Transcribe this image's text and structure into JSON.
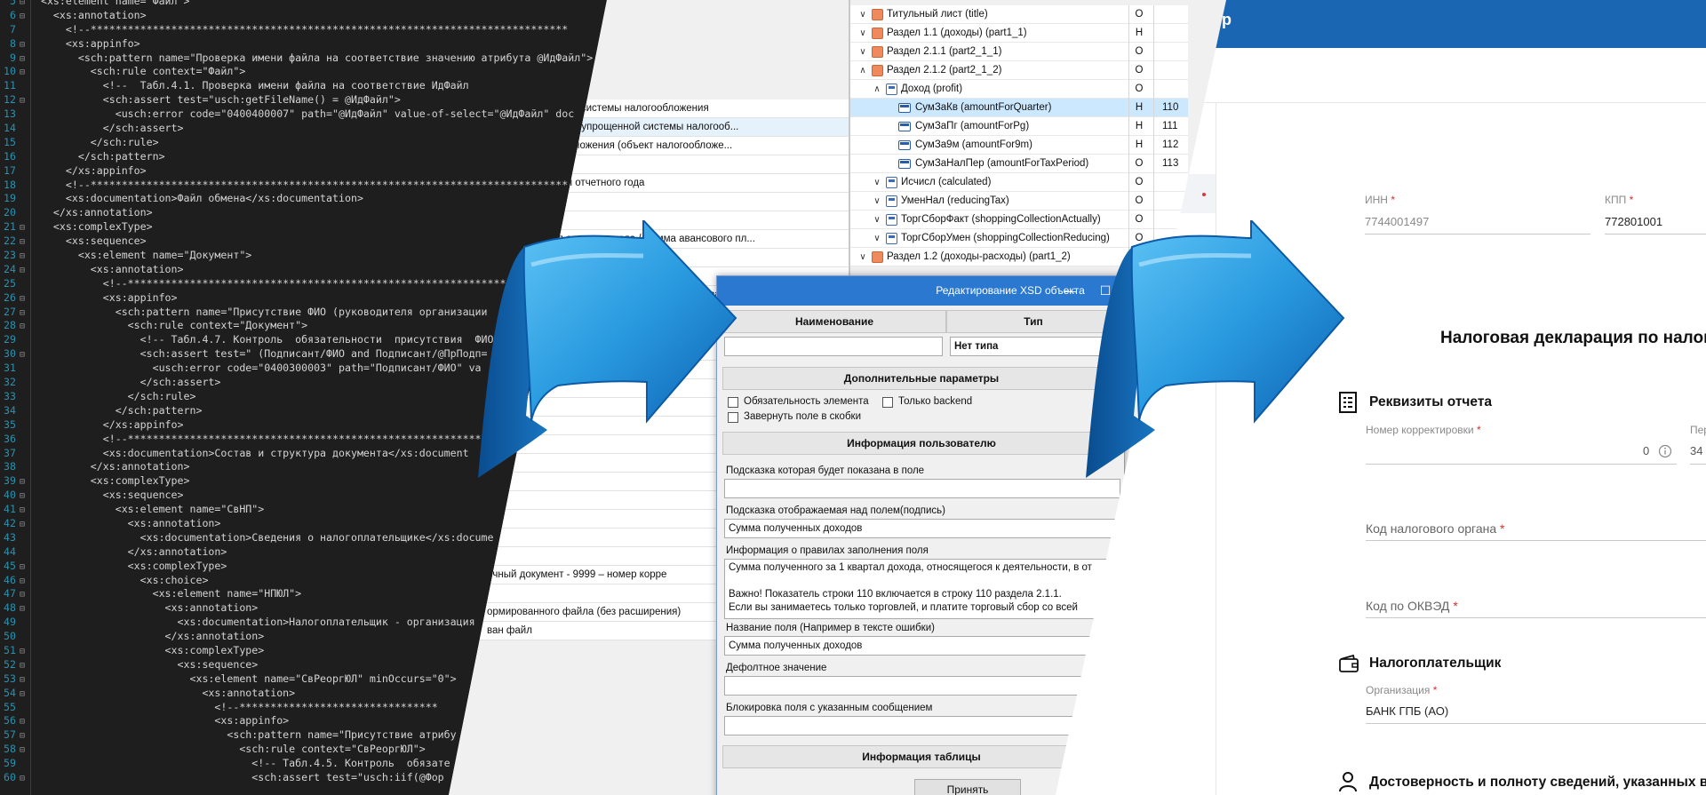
{
  "editor": {
    "lines": [
      {
        "n": "5",
        "fold": "⊟",
        "text": "  <xs:element name=\"Файл\">"
      },
      {
        "n": "6",
        "fold": "⊟",
        "text": "    <xs:annotation>"
      },
      {
        "n": "7",
        "fold": "",
        "text": "      <!--*****************************************************************************"
      },
      {
        "n": "8",
        "fold": "⊟",
        "text": "      <xs:appinfo>"
      },
      {
        "n": "9",
        "fold": "⊟",
        "text": "        <sch:pattern name=\"Проверка имени файла на соответствие значению атрибута @ИдФайл\">"
      },
      {
        "n": "10",
        "fold": "⊟",
        "text": "          <sch:rule context=\"Файл\">"
      },
      {
        "n": "11",
        "fold": "",
        "text": "            <!--  Табл.4.1. Проверка имени файла на соответствие ИдФайл"
      },
      {
        "n": "12",
        "fold": "⊟",
        "text": "            <sch:assert test=\"usch:getFileName() = @ИдФайл\">"
      },
      {
        "n": "13",
        "fold": "",
        "text": "              <usch:error code=\"0400400007\" path=\"@ИдФайл\" value-of-select=\"@ИдФайл\" doc"
      },
      {
        "n": "14",
        "fold": "",
        "text": "            </sch:assert>"
      },
      {
        "n": "15",
        "fold": "",
        "text": "          </sch:rule>"
      },
      {
        "n": "16",
        "fold": "",
        "text": "        </sch:pattern>"
      },
      {
        "n": "17",
        "fold": "",
        "text": "      </xs:appinfo>"
      },
      {
        "n": "18",
        "fold": "",
        "text": "      <!--*****************************************************************************"
      },
      {
        "n": "19",
        "fold": "",
        "text": "      <xs:documentation>Файл обмена</xs:documentation>"
      },
      {
        "n": "20",
        "fold": "",
        "text": "    </xs:annotation>"
      },
      {
        "n": "21",
        "fold": "⊟",
        "text": "    <xs:complexType>"
      },
      {
        "n": "22",
        "fold": "⊟",
        "text": "      <xs:sequence>"
      },
      {
        "n": "23",
        "fold": "⊟",
        "text": "        <xs:element name=\"Документ\">"
      },
      {
        "n": "24",
        "fold": "⊟",
        "text": "          <xs:annotation>"
      },
      {
        "n": "25",
        "fold": "",
        "text": "            <!--*************************************************************************"
      },
      {
        "n": "26",
        "fold": "⊟",
        "text": "            <xs:appinfo>"
      },
      {
        "n": "27",
        "fold": "⊟",
        "text": "              <sch:pattern name=\"Присутствие ФИО (руководителя организации"
      },
      {
        "n": "28",
        "fold": "⊟",
        "text": "                <sch:rule context=\"Документ\">"
      },
      {
        "n": "29",
        "fold": "",
        "text": "                  <!-- Табл.4.7. Контроль  обязательности  присутствия  ФИО"
      },
      {
        "n": "30",
        "fold": "⊟",
        "text": "                  <sch:assert test=\" (Подписант/ФИО and Подписант/@ПрПодп="
      },
      {
        "n": "31",
        "fold": "",
        "text": "                    <usch:error code=\"0400300003\" path=\"Подписант/ФИО\" va"
      },
      {
        "n": "32",
        "fold": "",
        "text": "                  </sch:assert>"
      },
      {
        "n": "33",
        "fold": "",
        "text": "                </sch:rule>"
      },
      {
        "n": "34",
        "fold": "",
        "text": "              </sch:pattern>"
      },
      {
        "n": "35",
        "fold": "",
        "text": "            </xs:appinfo>"
      },
      {
        "n": "36",
        "fold": "",
        "text": "            <!--*************************************************************************"
      },
      {
        "n": "37",
        "fold": "",
        "text": "            <xs:documentation>Состав и структура документа</xs:document"
      },
      {
        "n": "38",
        "fold": "",
        "text": "          </xs:annotation>"
      },
      {
        "n": "39",
        "fold": "⊟",
        "text": "          <xs:complexType>"
      },
      {
        "n": "40",
        "fold": "⊟",
        "text": "            <xs:sequence>"
      },
      {
        "n": "41",
        "fold": "⊟",
        "text": "              <xs:element name=\"СвНП\">"
      },
      {
        "n": "42",
        "fold": "⊟",
        "text": "                <xs:annotation>"
      },
      {
        "n": "43",
        "fold": "",
        "text": "                  <xs:documentation>Сведения о налогоплательщике</xs:docume"
      },
      {
        "n": "44",
        "fold": "",
        "text": "                </xs:annotation>"
      },
      {
        "n": "45",
        "fold": "⊟",
        "text": "                <xs:complexType>"
      },
      {
        "n": "46",
        "fold": "⊟",
        "text": "                  <xs:choice>"
      },
      {
        "n": "47",
        "fold": "⊟",
        "text": "                    <xs:element name=\"НПЮЛ\">"
      },
      {
        "n": "48",
        "fold": "⊟",
        "text": "                      <xs:annotation>"
      },
      {
        "n": "49",
        "fold": "",
        "text": "                        <xs:documentation>Налогоплательщик - организация"
      },
      {
        "n": "50",
        "fold": "",
        "text": "                      </xs:annotation>"
      },
      {
        "n": "51",
        "fold": "⊟",
        "text": "                      <xs:complexType>"
      },
      {
        "n": "52",
        "fold": "⊟",
        "text": "                        <xs:sequence>"
      },
      {
        "n": "53",
        "fold": "⊟",
        "text": "                          <xs:element name=\"СвРеоргЮЛ\" minOccurs=\"0\">"
      },
      {
        "n": "54",
        "fold": "⊟",
        "text": "                            <xs:annotation>"
      },
      {
        "n": "55",
        "fold": "",
        "text": "                              <!--********************************"
      },
      {
        "n": "56",
        "fold": "⊟",
        "text": "                              <xs:appinfo>"
      },
      {
        "n": "57",
        "fold": "⊟",
        "text": "                                <sch:pattern name=\"Присутствие атрибу"
      },
      {
        "n": "58",
        "fold": "⊟",
        "text": "                                  <sch:rule context=\"СвРеоргЮЛ\">"
      },
      {
        "n": "59",
        "fold": "",
        "text": "                                    <!-- Табл.4.5. Контроль  обязате"
      },
      {
        "n": "60",
        "fold": "⊟",
        "text": "                                    <sch:assert test=\"usch:iif(@Фор"
      }
    ]
  },
  "desktop": {
    "left_table_rows": [
      "ением упрощенной системы налогообложения",
      "язи с применением упрощенной  системы налогооб...",
      "системы налогообложения (объект налогообложе...",
      "",
      "ать пятого апреля отчетного года",
      "",
      "",
      "ать пятого июля отчетного года / Сумма авансового пл...",
      "",
      "",
      "дцать пятого октября отчетного года / Сумма авансового...",
      "",
      "Сумма",
      "",
      "",
      "",
      "",
      "",
      "",
      "",
      "",
      "",
      "",
      "",
      "",
      "ичный документ - 9999 – номер корре",
      "",
      "ормированного файла (без расширения)",
      "ван файл"
    ],
    "tree": [
      {
        "chev": "∨",
        "indent": 0,
        "icon": "folder",
        "label": "Титульный лист (title)",
        "req": "О",
        "code": ""
      },
      {
        "chev": "∨",
        "indent": 0,
        "icon": "folder",
        "label": "Раздел 1.1 (доходы) (part1_1)",
        "req": "Н",
        "code": ""
      },
      {
        "chev": "∨",
        "indent": 0,
        "icon": "folder",
        "label": "Раздел 2.1.1 (part2_1_1)",
        "req": "О",
        "code": ""
      },
      {
        "chev": "∧",
        "indent": 0,
        "icon": "folder",
        "label": "Раздел 2.1.2 (part2_1_2)",
        "req": "О",
        "code": ""
      },
      {
        "chev": "∧",
        "indent": 1,
        "icon": "elem",
        "label": "Доход (profit)",
        "req": "О",
        "code": ""
      },
      {
        "chev": "",
        "indent": 2,
        "icon": "field",
        "label": "СумЗаКв (amountForQuarter)",
        "req": "Н",
        "code": "110",
        "selected": true
      },
      {
        "chev": "",
        "indent": 2,
        "icon": "field",
        "label": "СумЗаПг (amountForPg)",
        "req": "Н",
        "code": "111"
      },
      {
        "chev": "",
        "indent": 2,
        "icon": "field",
        "label": "СумЗа9м (amountFor9m)",
        "req": "Н",
        "code": "112"
      },
      {
        "chev": "",
        "indent": 2,
        "icon": "field",
        "label": "СумЗаНалПер (amountForTaxPeriod)",
        "req": "О",
        "code": "113"
      },
      {
        "chev": "∨",
        "indent": 1,
        "icon": "elem",
        "label": "Исчисл (calculated)",
        "req": "О",
        "code": ""
      },
      {
        "chev": "∨",
        "indent": 1,
        "icon": "elem",
        "label": "УменНал (reducingTax)",
        "req": "О",
        "code": ""
      },
      {
        "chev": "∨",
        "indent": 1,
        "icon": "elem",
        "label": "ТоргСборФакт (shoppingCollectionActually)",
        "req": "О",
        "code": ""
      },
      {
        "chev": "∨",
        "indent": 1,
        "icon": "elem",
        "label": "ТоргСборУмен (shoppingCollectionReducing)",
        "req": "О",
        "code": ""
      },
      {
        "chev": "∨",
        "indent": 0,
        "icon": "folder",
        "label": "Раздел 1.2 (доходы-расходы) (part1_2)",
        "req": "",
        "code": ""
      }
    ],
    "dialog": {
      "title": "Редактирование XSD объекта",
      "minimize": "—",
      "maximize": "☐",
      "col_name": "Наименование",
      "col_type": "Тип",
      "name_value": "",
      "type_value": "Нет типа",
      "extra_params": "Дополнительные параметры",
      "chk_required": "Обязательность элемента",
      "chk_backend": "Только backend",
      "chk_brackets": "Завернуть поле в скобки",
      "user_info": "Информация пользователю",
      "hint_in_field_label": "Подсказка которая будет показана в поле",
      "hint_in_field_value": "",
      "hint_above_label": "Подсказка отображаемая над полем(подпись)",
      "hint_above_value": "Сумма полученных доходов",
      "rules_label": "Информация о правилах заполнения поля",
      "rules_line1": "Сумма полученного за 1 квартал дохода, относящегося к деятельности, в от",
      "rules_line2": "",
      "rules_line3": "Важно! Показатель строки 110 включается в строку 110 раздела 2.1.1.",
      "rules_line4": "Если вы занимаетесь только торговлей, и платите торговый сбор со всей",
      "field_name_label": "Название поля (Например в тексте ошибки)",
      "field_name_value": "Сумма полученных доходов",
      "default_label": "Дефолтное значение",
      "default_value": "",
      "block_label": "Блокировка поля с указанным сообщением",
      "block_value": "",
      "table_info": "Информация таблицы",
      "accept": "Принять"
    }
  },
  "web": {
    "topbar_text": "ор",
    "inn_label": "ИНН",
    "inn_value": "7744001497",
    "kpp_label": "КПП",
    "kpp_value": "772801001",
    "form_title": "Налоговая декларация по налог",
    "section_requisites": "Реквизиты отчета",
    "correction_label": "Номер корректировки",
    "correction_value": "0",
    "period_label": "Пер",
    "period_value": "34",
    "tax_authority": "Код налогового органа",
    "okved": "Код по ОКВЭД",
    "section_payer": "Налогоплательщик",
    "org_label": "Организация",
    "org_value": "БАНК ГПБ (АО)",
    "section_reliability": "Достоверность и полноту сведений, указанных в",
    "accent_color": "#1a66b3",
    "required_color": "#d32f2f"
  }
}
